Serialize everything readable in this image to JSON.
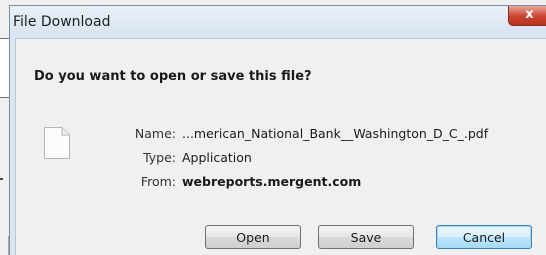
{
  "dialog": {
    "title": "File Download",
    "close_label": "x",
    "question": "Do you want to open or save this file?"
  },
  "file": {
    "icon": "document-icon",
    "name_label": "Name:",
    "name_value": "...merican_National_Bank__Washington_D_C_.pdf",
    "type_label": "Type:",
    "type_value": "Application",
    "from_label": "From:",
    "from_value": "webreports.mergent.com"
  },
  "buttons": {
    "open": "Open",
    "save": "Save",
    "cancel": "Cancel"
  },
  "colors": {
    "titlebar": "#dce6f2",
    "close_button": "#c9432e",
    "default_button_border": "#3c7fb1"
  }
}
